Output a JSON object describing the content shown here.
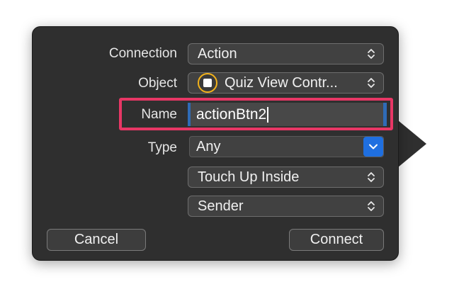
{
  "dialog": {
    "connection_label": "Connection",
    "connection_value": "Action",
    "object_label": "Object",
    "object_value": "Quiz View Contr...",
    "name_label": "Name",
    "name_value": "actionBtn2",
    "type_label": "Type",
    "type_value": "Any",
    "event_value": "Touch Up Inside",
    "arguments_value": "Sender",
    "cancel_label": "Cancel",
    "connect_label": "Connect"
  },
  "colors": {
    "panel": "#2f2f2f",
    "highlight": "#e73765",
    "accent_blue": "#1f6fe0",
    "object_icon_ring": "#f2b21b"
  },
  "icons": {
    "popup_indicator": "up-down-chevron-icon",
    "object_icon": "view-controller-icon",
    "combo_indicator": "chevron-down-icon"
  }
}
